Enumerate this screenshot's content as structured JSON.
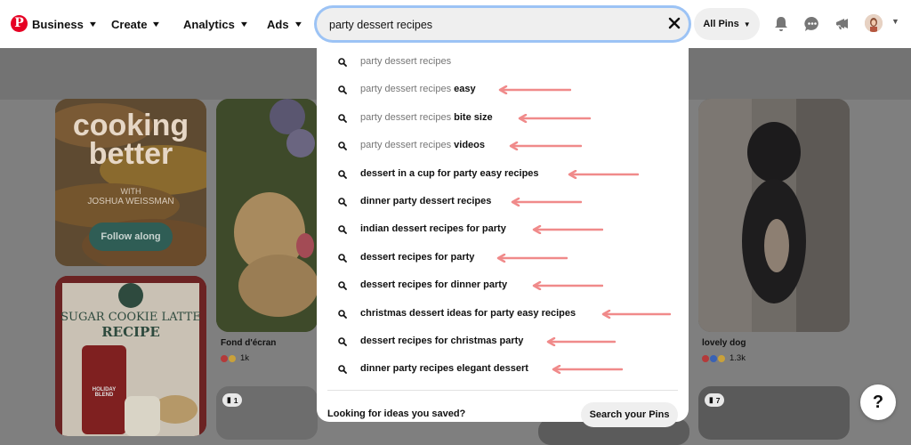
{
  "header": {
    "nav": [
      {
        "label": "Business"
      },
      {
        "label": "Create"
      },
      {
        "label": "Analytics"
      },
      {
        "label": "Ads"
      }
    ],
    "search_value": "party dessert recipes",
    "all_pins_label": "All Pins"
  },
  "suggestions": [
    {
      "prefix": "party dessert recipes",
      "bold": "",
      "arrow": false
    },
    {
      "prefix": "party dessert recipes ",
      "bold": "easy",
      "arrow": true
    },
    {
      "prefix": "party dessert recipes ",
      "bold": "bite size",
      "arrow": true
    },
    {
      "prefix": "party dessert recipes ",
      "bold": "videos",
      "arrow": true
    },
    {
      "prefix": "",
      "bold": "dessert in a cup for party easy recipes",
      "arrow": true
    },
    {
      "prefix": "",
      "bold": "dinner party dessert recipes",
      "arrow": true
    },
    {
      "prefix": "",
      "bold": "indian dessert recipes for party",
      "arrow": true
    },
    {
      "prefix": "",
      "bold": "dessert recipes for party",
      "arrow": true
    },
    {
      "prefix": "",
      "bold": "dessert recipes for dinner party",
      "arrow": true
    },
    {
      "prefix": "",
      "bold": "christmas dessert ideas for party easy recipes",
      "arrow": true
    },
    {
      "prefix": "",
      "bold": "dessert recipes for christmas party",
      "arrow": true
    },
    {
      "prefix": "",
      "bold": "dinner party recipes elegant dessert",
      "arrow": true
    }
  ],
  "footer": {
    "prompt": "Looking for ideas you saved?",
    "button": "Search your Pins"
  },
  "pins": {
    "cooking": {
      "line1": "cooking",
      "line2": "better",
      "with": "WITH",
      "author": "JOSHUA WEISSMAN",
      "follow": "Follow along"
    },
    "starbucks": {
      "line1": "SUGAR COOKIE LATTE",
      "line2": "RECIPE",
      "bag": "HOLIDAY BLEND"
    },
    "puppy": {
      "title": "Fond d'écran",
      "count": "1k"
    },
    "dog": {
      "title": "lovely dog",
      "count": "1.3k"
    },
    "badge_left": "1",
    "badge_right": "7"
  },
  "help_label": "?",
  "colors": {
    "brand": "#e60023",
    "arrow": "#f08a8a",
    "focus": "#9cc3f5"
  }
}
